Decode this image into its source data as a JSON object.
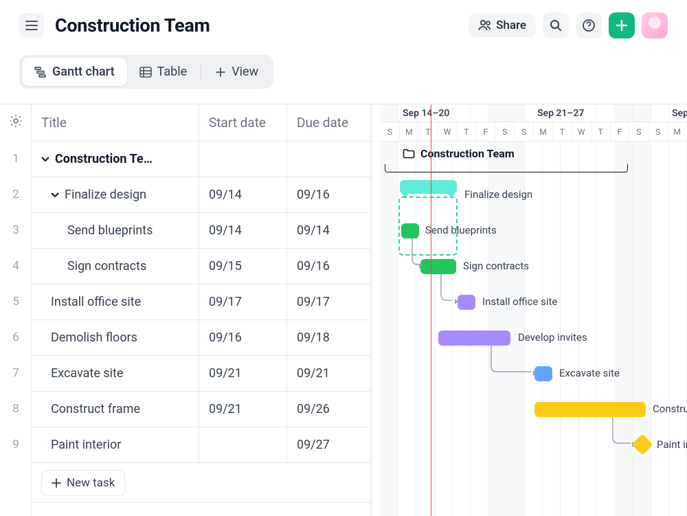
{
  "header": {
    "title": "Construction Team",
    "share_label": "Share"
  },
  "tabs": {
    "gantt": "Gantt chart",
    "table": "Table",
    "view": "View"
  },
  "columns": {
    "title": "Title",
    "start": "Start date",
    "due": "Due date"
  },
  "rows": [
    {
      "num": "1",
      "title": "Construction Te…",
      "start": "",
      "due": "",
      "bold": true,
      "collapsible": true,
      "indent": 0
    },
    {
      "num": "2",
      "title": "Finalize design",
      "start": "09/14",
      "due": "09/16",
      "collapsible": true,
      "indent": 1
    },
    {
      "num": "3",
      "title": "Send blueprints",
      "start": "09/14",
      "due": "09/14",
      "indent": 2
    },
    {
      "num": "4",
      "title": "Sign contracts",
      "start": "09/15",
      "due": "09/16",
      "indent": 2
    },
    {
      "num": "5",
      "title": "Install office site",
      "start": "09/17",
      "due": "09/17",
      "indent": 1
    },
    {
      "num": "6",
      "title": "Demolish floors",
      "start": "09/16",
      "due": "09/18",
      "indent": 1
    },
    {
      "num": "7",
      "title": "Excavate site",
      "start": "09/21",
      "due": "09/21",
      "indent": 1
    },
    {
      "num": "8",
      "title": "Construct frame",
      "start": "09/21",
      "due": "09/26",
      "indent": 1
    },
    {
      "num": "9",
      "title": "Paint interior",
      "start": "",
      "due": "09/27",
      "indent": 1
    }
  ],
  "new_task_label": "New task",
  "timeline": {
    "week_labels": [
      "Sep 14–20",
      "Sep 21–27",
      "Sep"
    ],
    "day_letters": [
      "S",
      "M",
      "T",
      "W",
      "T",
      "F",
      "S",
      "S",
      "M",
      "T",
      "W",
      "T",
      "F",
      "S",
      "S",
      "M"
    ],
    "project_label": "Construction Team",
    "bars": {
      "finalize": "Finalize design",
      "blueprints": "Send blueprints",
      "contracts": "Sign contracts",
      "install": "Install office site",
      "develop": "Develop invites",
      "excavate": "Excavate site",
      "frame": "Construct fra",
      "paint": "Paint inter"
    },
    "colors": {
      "teal": "#5eead4",
      "green": "#22c55e",
      "purple": "#a78bfa",
      "blue": "#60a5fa",
      "yellow": "#facc15"
    }
  }
}
